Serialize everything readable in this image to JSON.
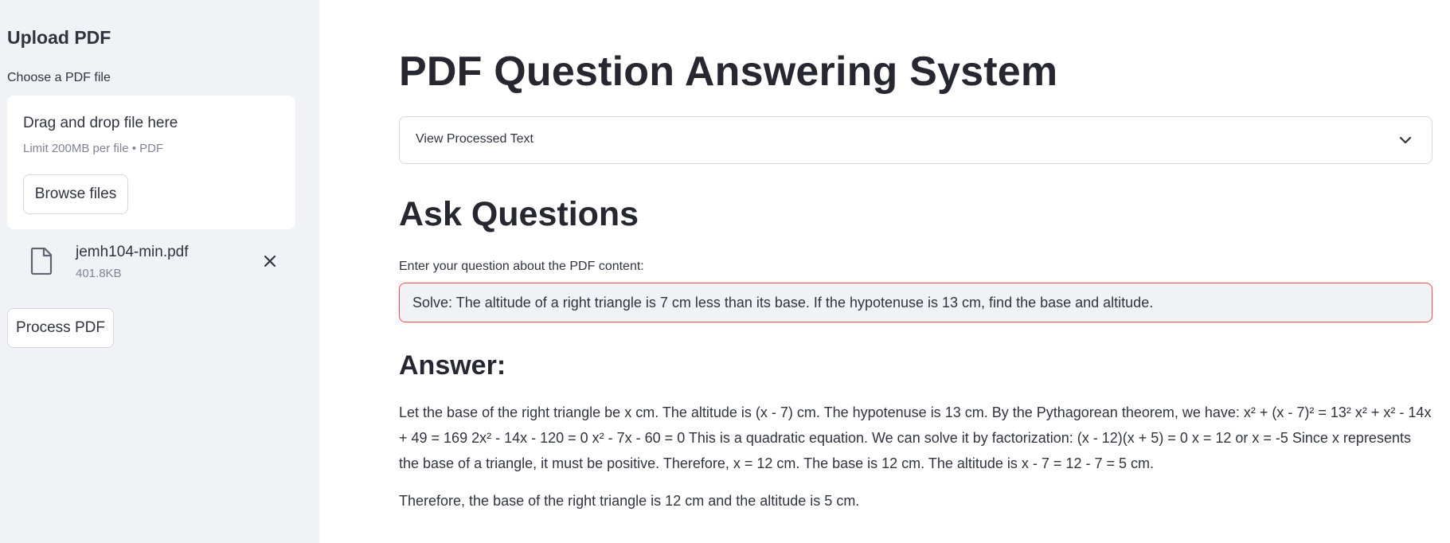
{
  "sidebar": {
    "title": "Upload PDF",
    "uploader_label": "Choose a PDF file",
    "dropzone": {
      "title": "Drag and drop file here",
      "limit": "Limit 200MB per file • PDF",
      "browse_label": "Browse files"
    },
    "file": {
      "name": "jemh104-min.pdf",
      "size": "401.8KB",
      "icon": "file-icon",
      "remove_icon": "close-icon"
    },
    "process_label": "Process PDF"
  },
  "main": {
    "title": "PDF Question Answering System",
    "expander": {
      "label": "View Processed Text",
      "icon": "chevron-down-icon"
    },
    "ask_heading": "Ask Questions",
    "question": {
      "label": "Enter your question about the PDF content:",
      "value": "Solve: The altitude of a right triangle is 7 cm less than its base. If the hypotenuse is 13 cm, find the base and altitude."
    },
    "answer_heading": "Answer:",
    "answer_text": "Let the base of the right triangle be x cm. The altitude is (x - 7) cm. The hypotenuse is 13 cm. By the Pythagorean theorem, we have: x² + (x - 7)² = 13² x² + x² - 14x + 49 = 169 2x² - 14x - 120 = 0 x² - 7x - 60 = 0 This is a quadratic equation. We can solve it by factorization: (x - 12)(x + 5) = 0 x = 12 or x = -5 Since x represents the base of a triangle, it must be positive. Therefore, x = 12 cm. The base is 12 cm. The altitude is x - 7 = 12 - 7 = 5 cm.",
    "conclusion_text": "Therefore, the base of the right triangle is 12 cm and the altitude is 5 cm."
  },
  "colors": {
    "sidebar_bg": "#f0f2f6",
    "text": "#31333f",
    "muted": "#808495",
    "input_focus_border": "#ff4b4b"
  }
}
